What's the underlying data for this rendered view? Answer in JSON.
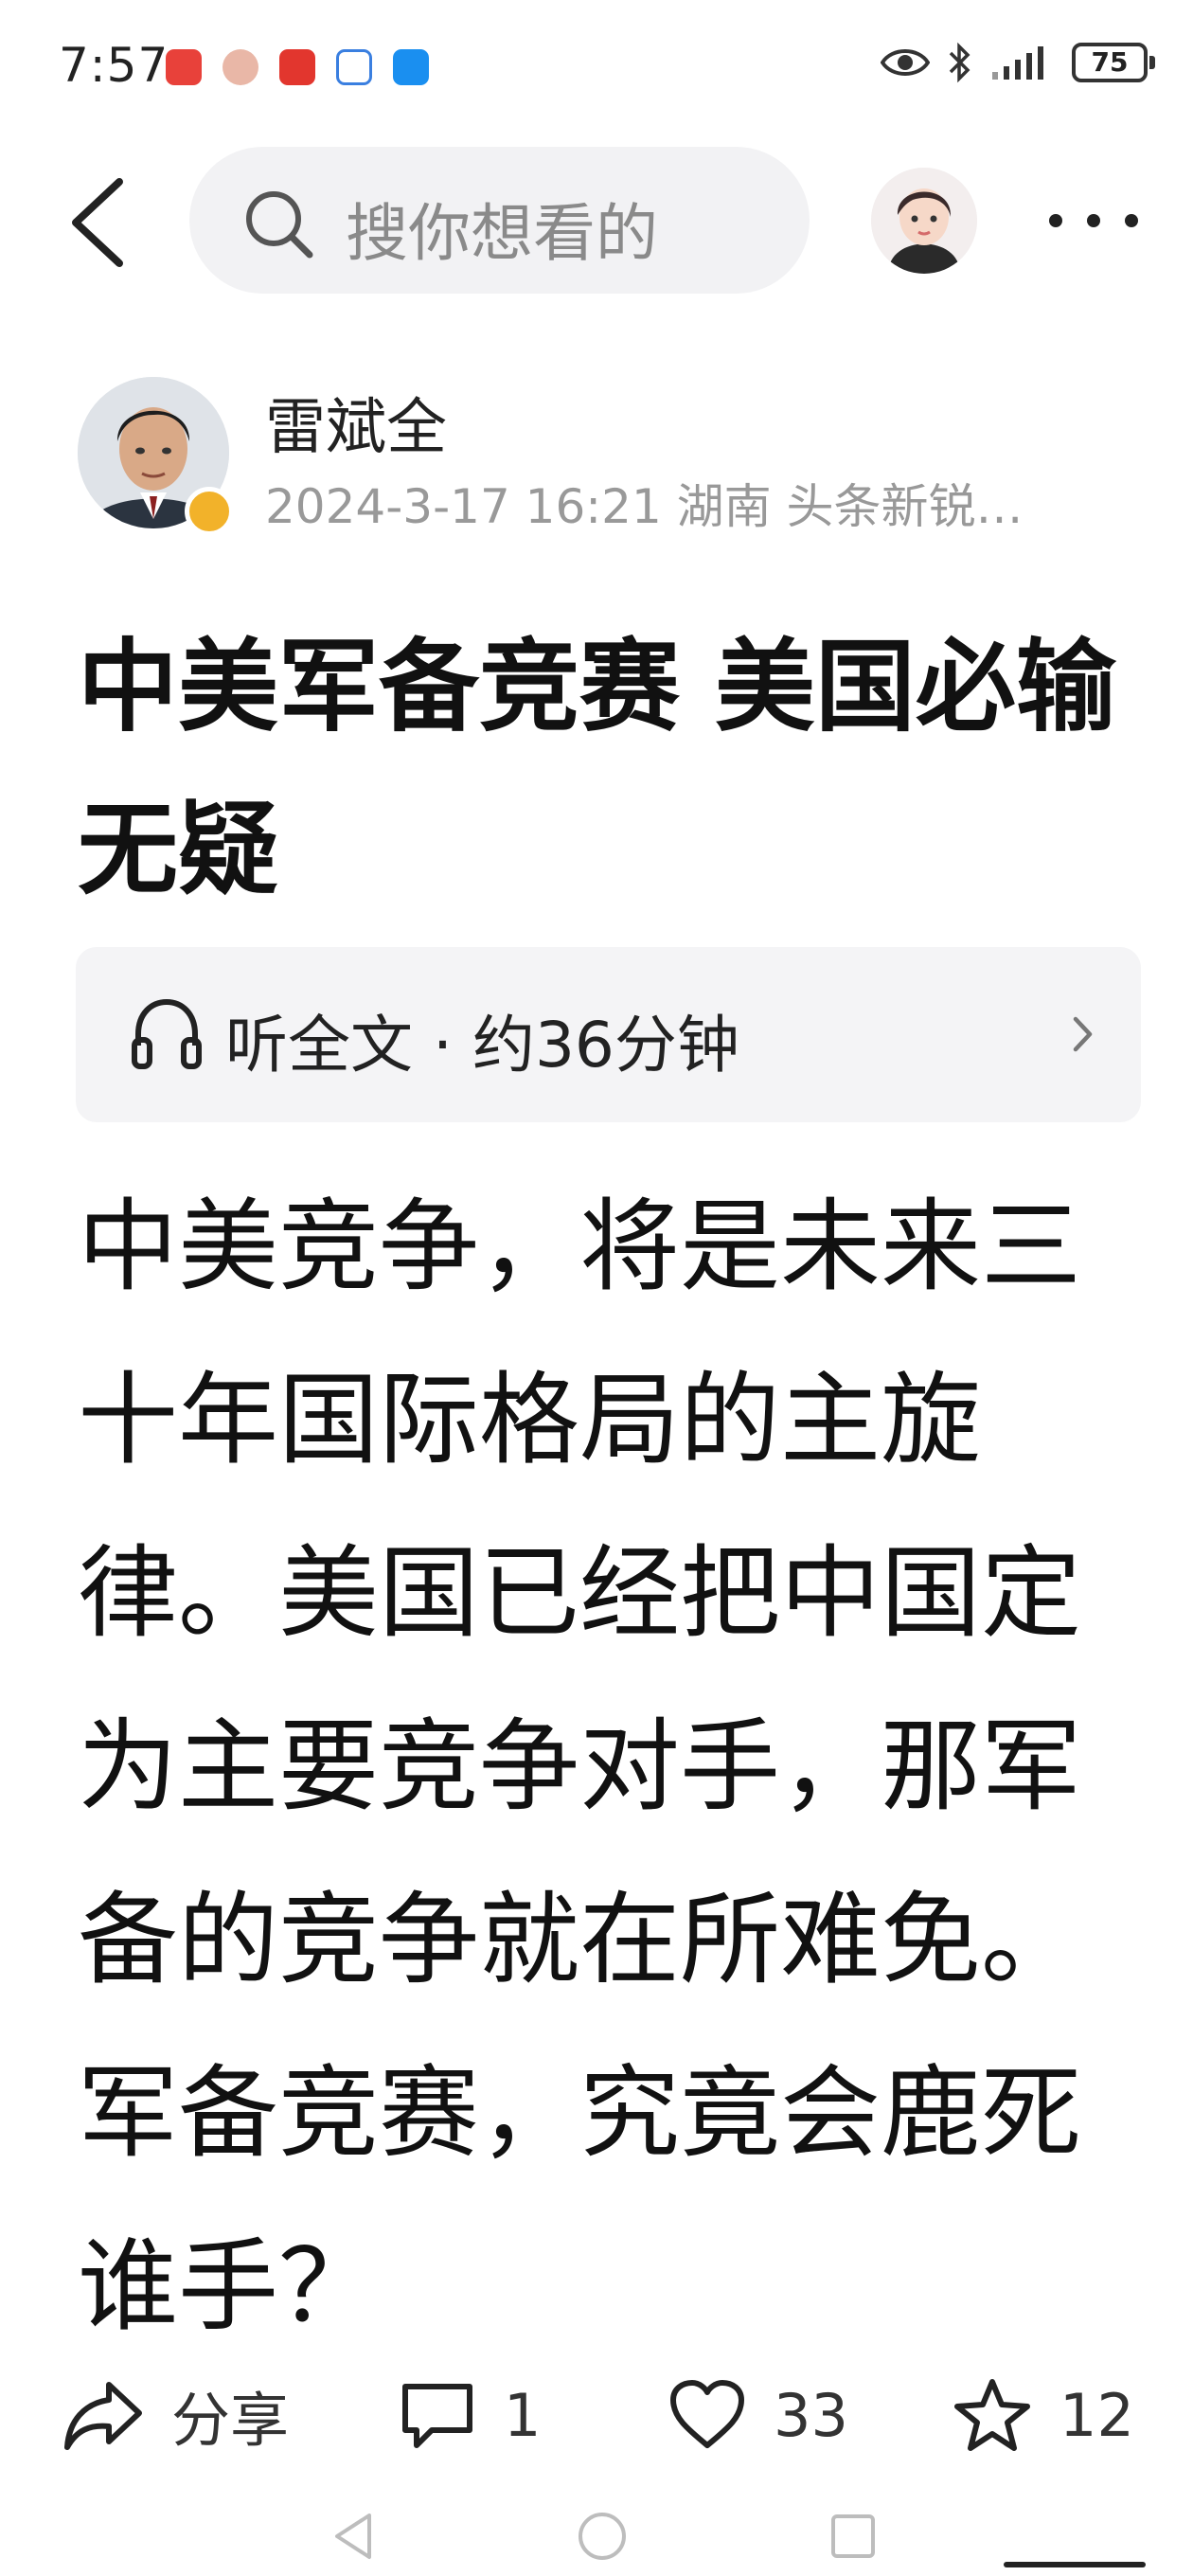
{
  "status_bar": {
    "time": "7:57",
    "battery": "75",
    "app_icons": [
      "huawei-app-icon",
      "avatar-app-icon",
      "red-app-icon",
      "blue-app-icon",
      "search-app-icon"
    ]
  },
  "nav": {
    "search_placeholder": "搜你想看的"
  },
  "author": {
    "name": "雷斌全",
    "meta": "2024-3-17  16:21  湖南  头条新锐…"
  },
  "article": {
    "title": "中美军备竞赛 美国必输无疑",
    "listen_label": "听全文 · 约36分钟",
    "body": "中美竞争，将是未来三十年国际格局的主旋律。美国已经把中国定为主要竞争对手，那军备的竞争就在所难免。军备竞赛，究竟会鹿死谁手？"
  },
  "actions": {
    "share_label": "分享",
    "comment_count": "1",
    "like_count": "33",
    "favorite_count": "12"
  },
  "colors": {
    "muted_text": "#999999",
    "listen_bg": "#f4f4f6",
    "search_bg": "#f2f2f4",
    "badge": "#f2b22a"
  }
}
